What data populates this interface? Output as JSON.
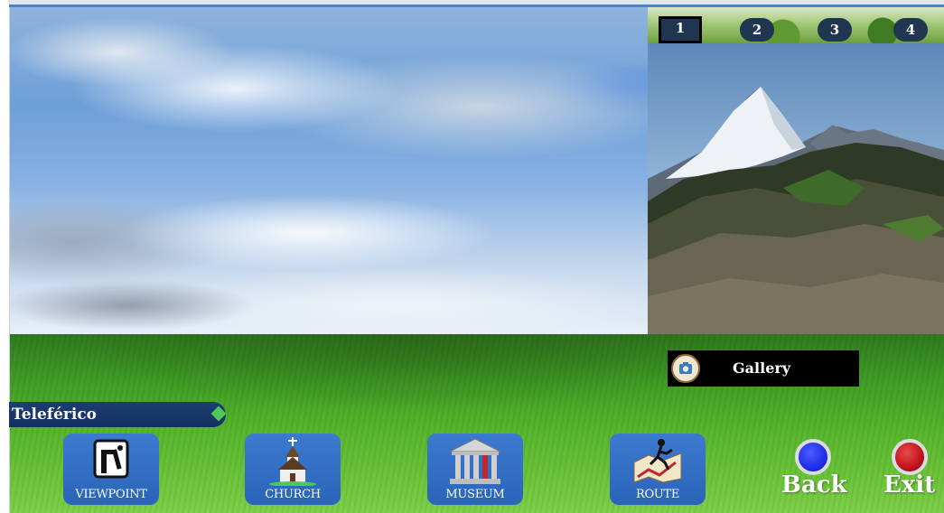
{
  "thumbnail_tabs": [
    {
      "label": "1",
      "active": true
    },
    {
      "label": "2",
      "active": false
    },
    {
      "label": "3",
      "active": false
    },
    {
      "label": "4",
      "active": false
    }
  ],
  "gallery": {
    "label": "Gallery",
    "icon": "camera-icon"
  },
  "location": {
    "label": "Teleférico"
  },
  "nav_buttons": [
    {
      "label": "VIEWPOINT",
      "icon": "viewpoint-icon"
    },
    {
      "label": "CHURCH",
      "icon": "church-icon"
    },
    {
      "label": "MUSEUM",
      "icon": "museum-icon"
    },
    {
      "label": "ROUTE",
      "icon": "route-icon"
    }
  ],
  "back": {
    "label": "Back",
    "color": "#1e2fe8"
  },
  "exit": {
    "label": "Exit",
    "color": "#c0121a"
  },
  "colors": {
    "button_blue": "#2f6dc4",
    "location_bar": "#1b3a6e",
    "marker_green": "#4cc95a"
  }
}
